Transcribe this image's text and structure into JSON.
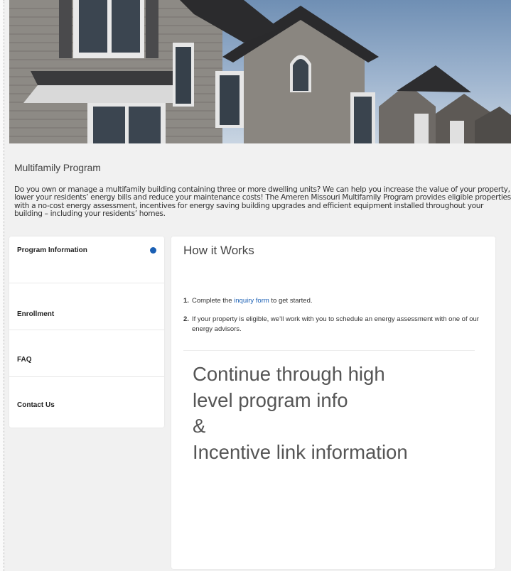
{
  "hero": {
    "image_icon": "townhouses-photo-icon"
  },
  "program": {
    "title": "Multifamily Program",
    "intro": "Do you own or manage a multifamily building containing three or more dwelling units? We can help you increase the value of your property, lower your residents’ energy bills and reduce your maintenance costs! The Ameren Missouri Multifamily Program provides eligible properties with a no-cost energy assessment, incentives for energy saving building upgrades and efficient equipment installed throughout your building – including your residents’ homes."
  },
  "nav": {
    "items": [
      {
        "label": "Program Information",
        "active": true
      },
      {
        "label": "Enrollment"
      },
      {
        "label": "FAQ"
      },
      {
        "label": "Contact Us"
      }
    ],
    "active_color": "#1a5fb4"
  },
  "content": {
    "heading": "How it Works",
    "steps": [
      {
        "num": "1.",
        "before": "Complete the ",
        "link": "inquiry form",
        "after": " to get started."
      },
      {
        "num": "2.",
        "text": "If your property is eligible, we’ll work with you to schedule an energy assessment with one of our energy advisors."
      }
    ],
    "overlay_lines": [
      "Continue through high",
      "level program info",
      "&",
      "Incentive link information"
    ]
  },
  "colors": {
    "link": "#1a5fb4",
    "background": "#f1f1f1"
  }
}
